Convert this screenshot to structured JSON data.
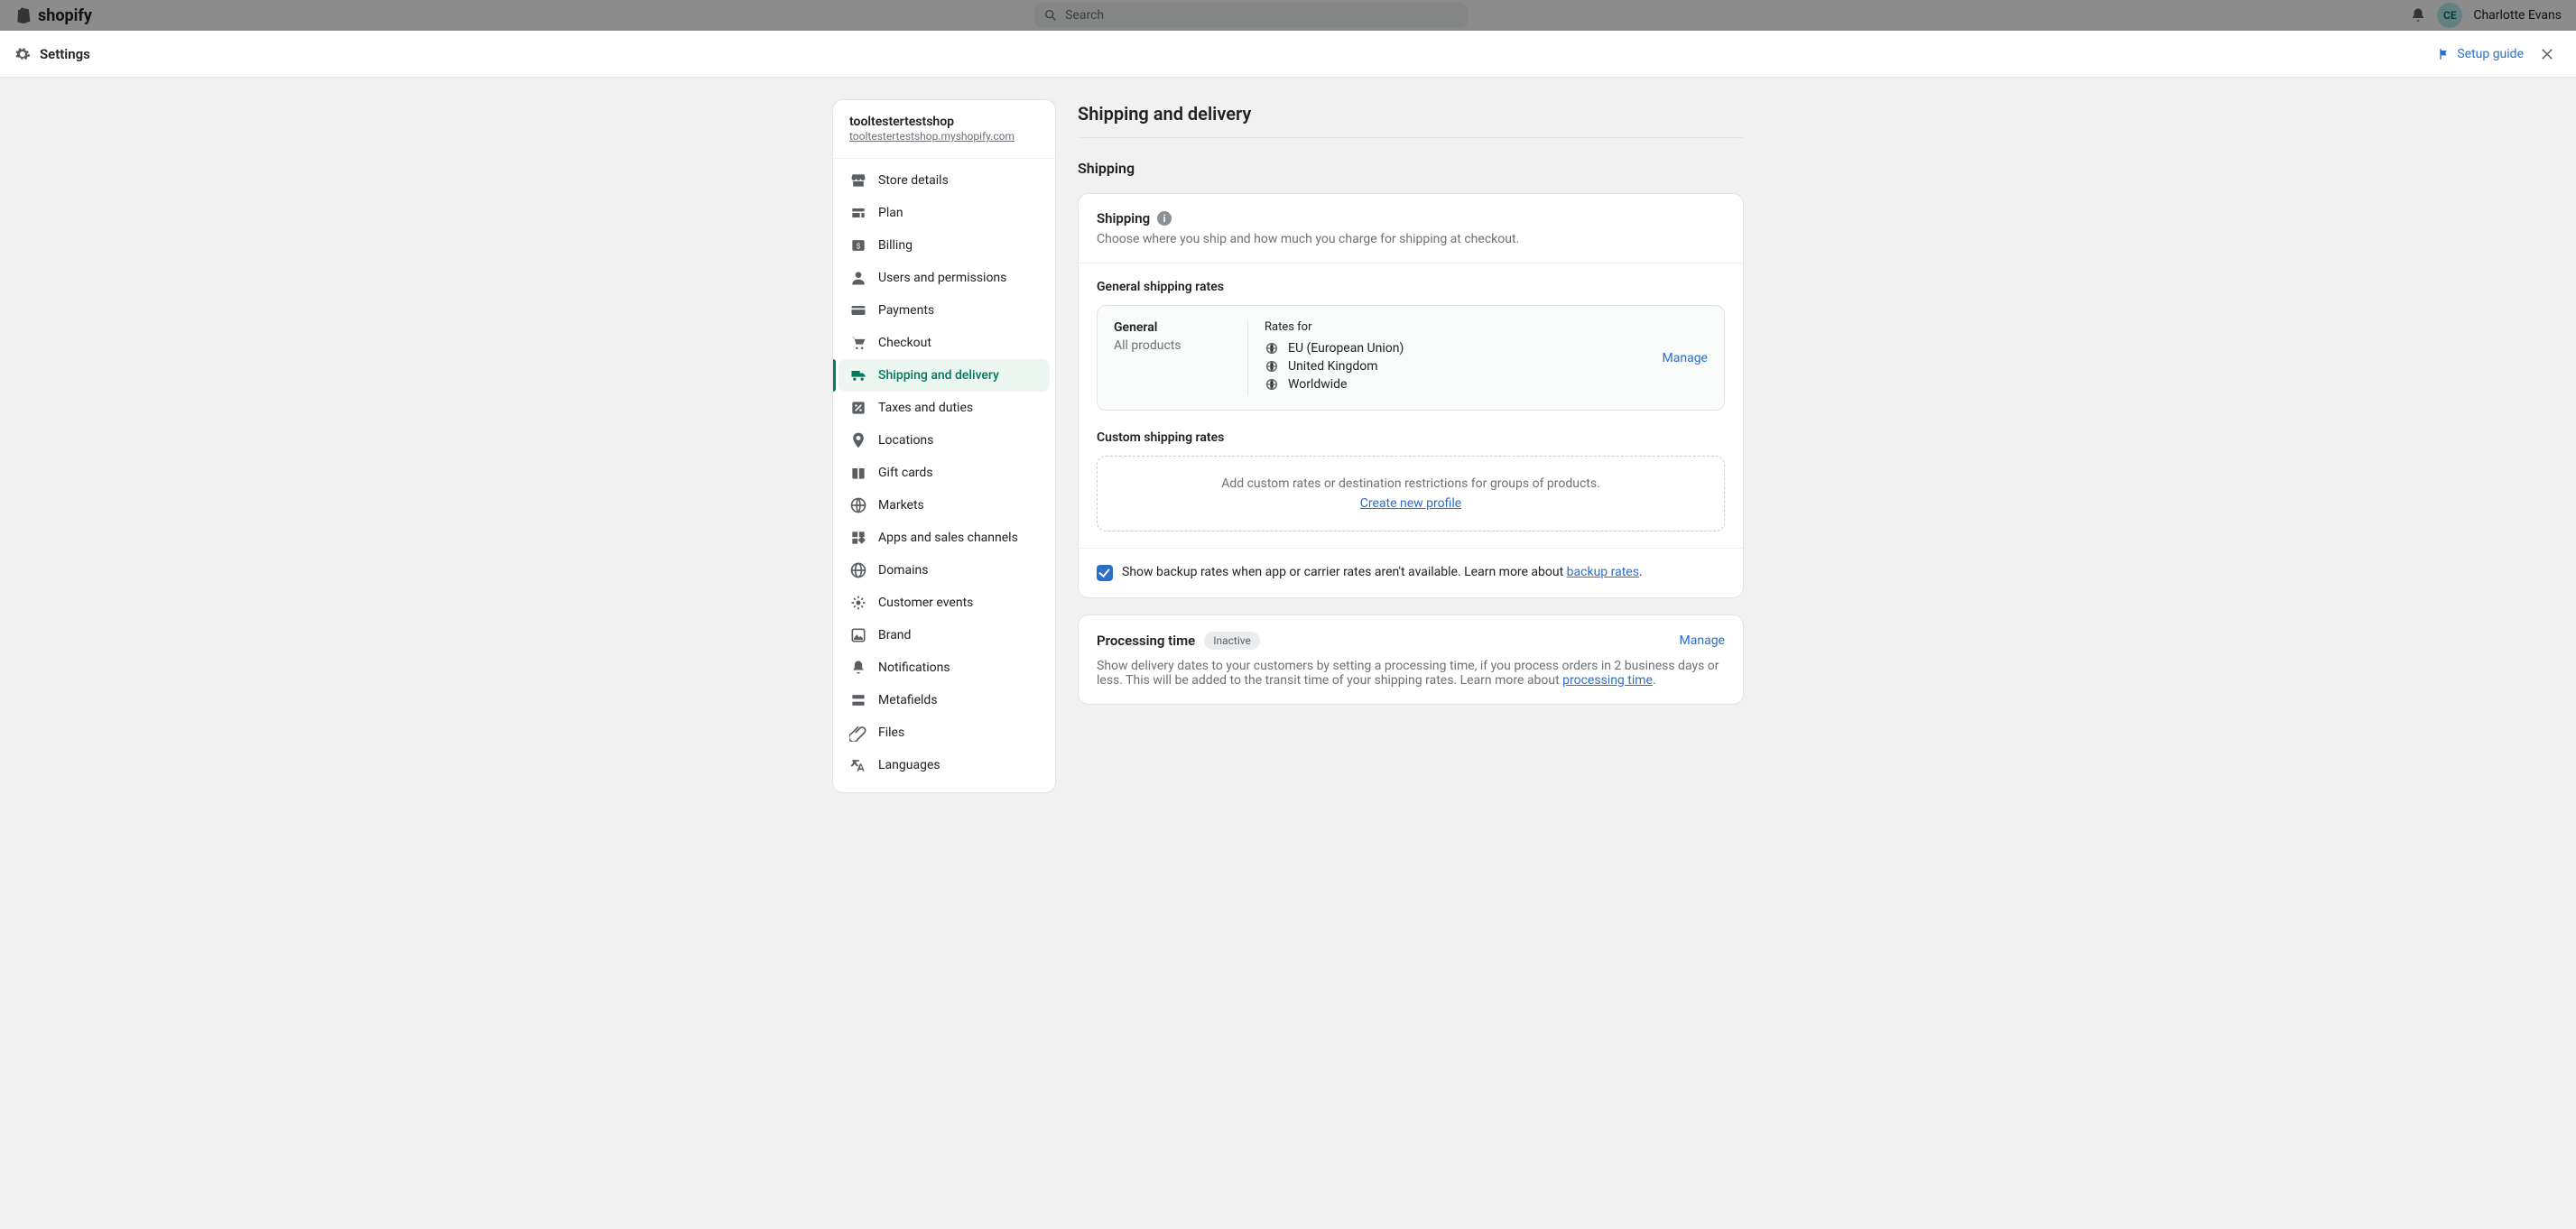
{
  "topbar": {
    "brand": "shopify",
    "search_placeholder": "Search",
    "user_initials": "CE",
    "user_name": "Charlotte Evans"
  },
  "header": {
    "title": "Settings",
    "setup_guide": "Setup guide"
  },
  "store": {
    "name": "tooltestertestshop",
    "domain": "tooltestertestshop.myshopify.com"
  },
  "nav": {
    "store_details": "Store details",
    "plan": "Plan",
    "billing": "Billing",
    "users": "Users and permissions",
    "payments": "Payments",
    "checkout": "Checkout",
    "shipping": "Shipping and delivery",
    "taxes": "Taxes and duties",
    "locations": "Locations",
    "gift_cards": "Gift cards",
    "markets": "Markets",
    "apps": "Apps and sales channels",
    "domains": "Domains",
    "customer_events": "Customer events",
    "brand": "Brand",
    "notifications": "Notifications",
    "metafields": "Metafields",
    "files": "Files",
    "languages": "Languages"
  },
  "page": {
    "title": "Shipping and delivery",
    "shipping_heading": "Shipping"
  },
  "shipping_card": {
    "title": "Shipping",
    "info_glyph": "i",
    "description": "Choose where you ship and how much you charge for shipping at checkout.",
    "general_heading": "General shipping rates",
    "profile": {
      "name": "General",
      "products": "All products",
      "rates_for_label": "Rates for",
      "zones": [
        "EU (European Union)",
        "United Kingdom",
        "Worldwide"
      ],
      "manage": "Manage"
    },
    "custom_heading": "Custom shipping rates",
    "custom_empty_text": "Add custom rates or destination restrictions for groups of products.",
    "create_profile": "Create new profile",
    "backup_prefix": "Show backup rates when app or carrier rates aren't available. Learn more about ",
    "backup_link": "backup rates",
    "backup_suffix": "."
  },
  "processing_card": {
    "title": "Processing time",
    "badge": "Inactive",
    "manage": "Manage",
    "desc_prefix": "Show delivery dates to your customers by setting a processing time, if you process orders in 2 business days or less. This will be added to the transit time of your shipping rates. Learn more about ",
    "desc_link": "processing time",
    "desc_suffix": "."
  }
}
